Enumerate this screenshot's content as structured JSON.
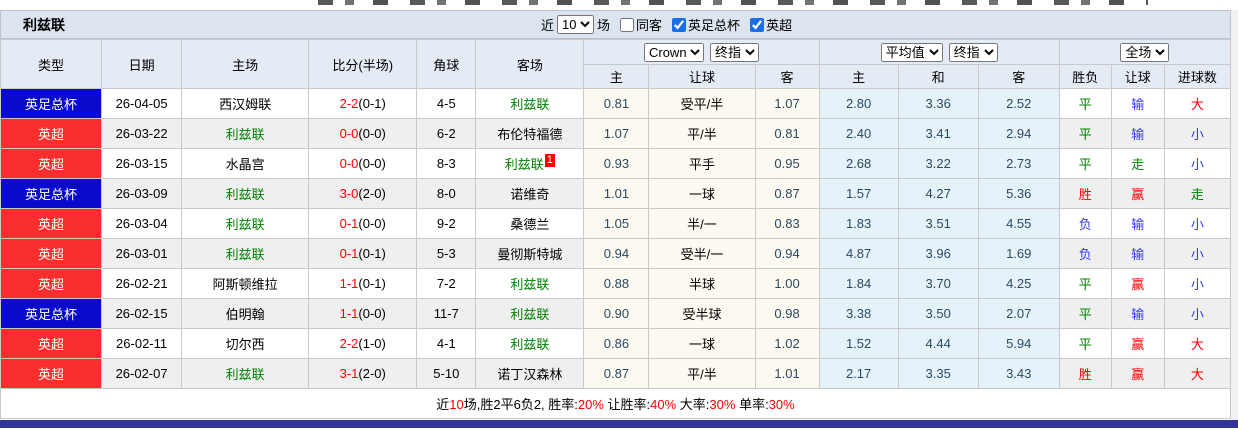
{
  "toolbar": {
    "title": "利兹联",
    "recent_label": "近",
    "recent_value": "10",
    "matches_label": "场",
    "filters": [
      {
        "label": "同客",
        "checked": false
      },
      {
        "label": "英足总杯",
        "checked": true
      },
      {
        "label": "英超",
        "checked": true
      }
    ]
  },
  "header": {
    "cols": [
      "类型",
      "日期",
      "主场",
      "比分(半场)",
      "角球",
      "客场"
    ],
    "sub_cols": [
      "主",
      "让球",
      "客",
      "主",
      "和",
      "客",
      "胜负",
      "让球",
      "进球数"
    ],
    "selects": {
      "crown": "Crown",
      "final1": "终指",
      "average": "平均值",
      "final2": "终指",
      "scope": "全场"
    }
  },
  "rows": [
    {
      "type": "英足总杯",
      "date": "26-04-05",
      "home": "西汉姆联",
      "score": "2-2",
      "half": "(0-1)",
      "corners": "4-5",
      "away": "利兹联",
      "away_badge": "",
      "crown": [
        "0.81",
        "受平/半",
        "1.07"
      ],
      "avg": [
        "2.80",
        "3.36",
        "2.52"
      ],
      "result": [
        "平",
        "输",
        "大"
      ]
    },
    {
      "type": "英超",
      "date": "26-03-22",
      "home": "利兹联",
      "score": "0-0",
      "half": "(0-0)",
      "corners": "6-2",
      "away": "布伦特福德",
      "away_badge": "",
      "crown": [
        "1.07",
        "平/半",
        "0.81"
      ],
      "avg": [
        "2.40",
        "3.41",
        "2.94"
      ],
      "result": [
        "平",
        "输",
        "小"
      ]
    },
    {
      "type": "英超",
      "date": "26-03-15",
      "home": "水晶宫",
      "score": "0-0",
      "half": "(0-0)",
      "corners": "8-3",
      "away": "利兹联",
      "away_badge": "1",
      "crown": [
        "0.93",
        "平手",
        "0.95"
      ],
      "avg": [
        "2.68",
        "3.22",
        "2.73"
      ],
      "result": [
        "平",
        "走",
        "小"
      ]
    },
    {
      "type": "英足总杯",
      "date": "26-03-09",
      "home": "利兹联",
      "score": "3-0",
      "half": "(2-0)",
      "corners": "8-0",
      "away": "诺维奇",
      "away_badge": "",
      "crown": [
        "1.01",
        "一球",
        "0.87"
      ],
      "avg": [
        "1.57",
        "4.27",
        "5.36"
      ],
      "result": [
        "胜",
        "赢",
        "走"
      ]
    },
    {
      "type": "英超",
      "date": "26-03-04",
      "home": "利兹联",
      "score": "0-1",
      "half": "(0-0)",
      "corners": "9-2",
      "away": "桑德兰",
      "away_badge": "",
      "crown": [
        "1.05",
        "半/一",
        "0.83"
      ],
      "avg": [
        "1.83",
        "3.51",
        "4.55"
      ],
      "result": [
        "负",
        "输",
        "小"
      ]
    },
    {
      "type": "英超",
      "date": "26-03-01",
      "home": "利兹联",
      "score": "0-1",
      "half": "(0-1)",
      "corners": "5-3",
      "away": "曼彻斯特城",
      "away_badge": "",
      "crown": [
        "0.94",
        "受半/一",
        "0.94"
      ],
      "avg": [
        "4.87",
        "3.96",
        "1.69"
      ],
      "result": [
        "负",
        "输",
        "小"
      ]
    },
    {
      "type": "英超",
      "date": "26-02-21",
      "home": "阿斯顿维拉",
      "score": "1-1",
      "half": "(0-1)",
      "corners": "7-2",
      "away": "利兹联",
      "away_badge": "",
      "crown": [
        "0.88",
        "半球",
        "1.00"
      ],
      "avg": [
        "1.84",
        "3.70",
        "4.25"
      ],
      "result": [
        "平",
        "赢",
        "小"
      ]
    },
    {
      "type": "英足总杯",
      "date": "26-02-15",
      "home": "伯明翰",
      "score": "1-1",
      "half": "(0-0)",
      "corners": "11-7",
      "away": "利兹联",
      "away_badge": "",
      "crown": [
        "0.90",
        "受半球",
        "0.98"
      ],
      "avg": [
        "3.38",
        "3.50",
        "2.07"
      ],
      "result": [
        "平",
        "输",
        "小"
      ]
    },
    {
      "type": "英超",
      "date": "26-02-11",
      "home": "切尔西",
      "score": "2-2",
      "half": "(1-0)",
      "corners": "4-1",
      "away": "利兹联",
      "away_badge": "",
      "crown": [
        "0.86",
        "一球",
        "1.02"
      ],
      "avg": [
        "1.52",
        "4.44",
        "5.94"
      ],
      "result": [
        "平",
        "赢",
        "大"
      ]
    },
    {
      "type": "英超",
      "date": "26-02-07",
      "home": "利兹联",
      "score": "3-1",
      "half": "(2-0)",
      "corners": "5-10",
      "away": "诺丁汉森林",
      "away_badge": "",
      "crown": [
        "0.87",
        "平/半",
        "1.01"
      ],
      "avg": [
        "2.17",
        "3.35",
        "3.43"
      ],
      "result": [
        "胜",
        "赢",
        "大"
      ]
    }
  ],
  "footer": {
    "segments": [
      {
        "text": "近"
      },
      {
        "text": "10",
        "red": true
      },
      {
        "text": "场,胜2平6负2, 胜率:"
      },
      {
        "text": "20%",
        "red": true
      },
      {
        "text": " 让胜率:"
      },
      {
        "text": "40%",
        "red": true
      },
      {
        "text": " 大率:"
      },
      {
        "text": "30%",
        "red": true
      },
      {
        "text": " 单率:"
      },
      {
        "text": "30%",
        "red": true
      }
    ]
  },
  "colors": {
    "type_blue": "#0a0acd",
    "type_red": "#fa2e2e",
    "team_green": "#008000",
    "score_red": "#ff0000",
    "odds_text": "#2b4a63",
    "crown_bg": "#fcf9f0",
    "avg_bg": "#e6f2f9",
    "toolbar_bg": "#dce4ef",
    "header_bg": "#e4ebf5",
    "stripe_bg": "#efefef",
    "bottom_bar": "#333399",
    "result_map": {
      "胜": "red",
      "平": "green",
      "负": "blue",
      "赢": "red",
      "走": "green",
      "输": "blue",
      "大": "red",
      "小": "blue"
    },
    "type_class": {
      "英足总杯": "type-blue",
      "英超": "type-red"
    }
  }
}
